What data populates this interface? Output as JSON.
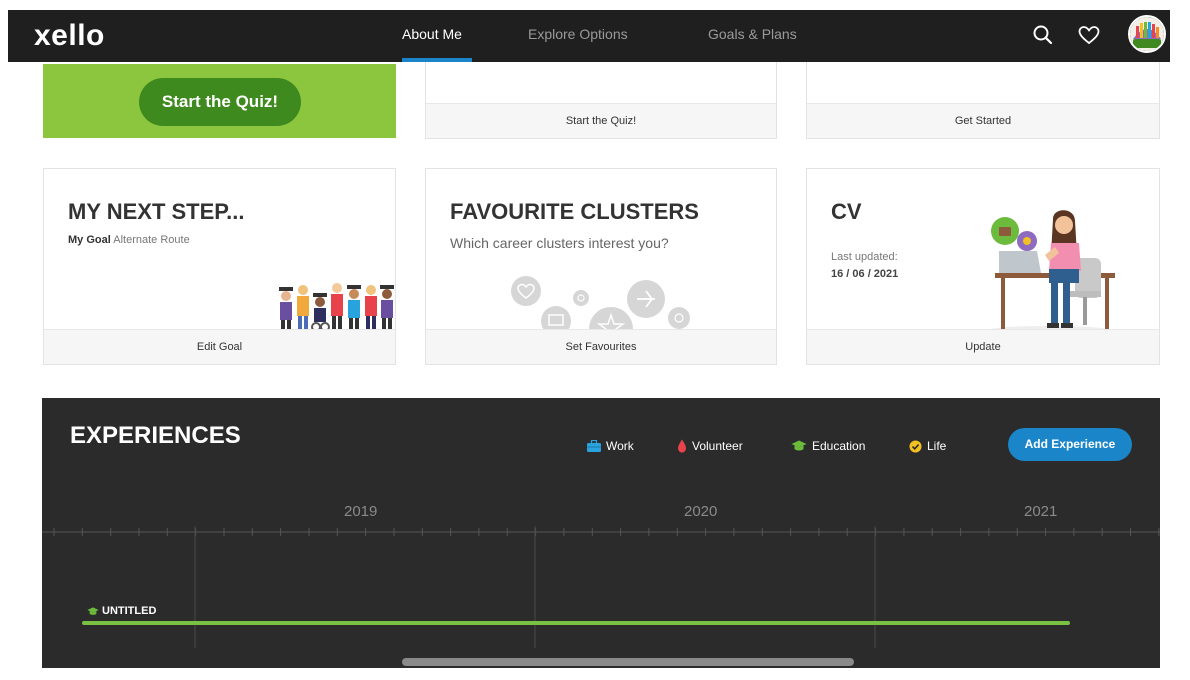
{
  "nav": {
    "logo": "xello",
    "tabs": [
      {
        "label": "About Me",
        "active": true
      },
      {
        "label": "Explore Options",
        "active": false
      },
      {
        "label": "Goals & Plans",
        "active": false
      }
    ],
    "icons": [
      "search-icon",
      "heart-icon"
    ]
  },
  "top_row": {
    "quiz_cta": "Start the Quiz!",
    "middle_footer": "Start the Quiz!",
    "right_footer": "Get Started"
  },
  "cards": {
    "next_step": {
      "title": "MY NEXT STEP...",
      "goal_label": "My Goal",
      "goal_value": "Alternate Route",
      "footer": "Edit Goal"
    },
    "favourite_clusters": {
      "title": "FAVOURITE CLUSTERS",
      "subtitle": "Which career clusters interest you?",
      "footer": "Set Favourites"
    },
    "cv": {
      "title": "CV",
      "updated_label": "Last updated:",
      "updated_date": "16 / 06 / 2021",
      "footer": "Update"
    }
  },
  "experiences": {
    "title": "EXPERIENCES",
    "legend": [
      {
        "label": "Work",
        "icon": "briefcase-icon",
        "color": "#29a3dd"
      },
      {
        "label": "Volunteer",
        "icon": "hand-icon",
        "color": "#e8434b"
      },
      {
        "label": "Education",
        "icon": "graduation-cap-icon",
        "color": "#6cbb3c"
      },
      {
        "label": "Life",
        "icon": "check-circle-icon",
        "color": "#f2c023"
      }
    ],
    "add_button": "Add Experience",
    "years": [
      "2019",
      "2020",
      "2021"
    ],
    "items": [
      {
        "label": "UNTITLED",
        "category": "Education"
      }
    ]
  },
  "colors": {
    "nav_bg": "#1f1f1f",
    "accent_blue": "#1a86c9",
    "quiz_green": "#8cc63f",
    "timeline_bg": "#2b2b2b",
    "bar_green": "#7ac043"
  }
}
